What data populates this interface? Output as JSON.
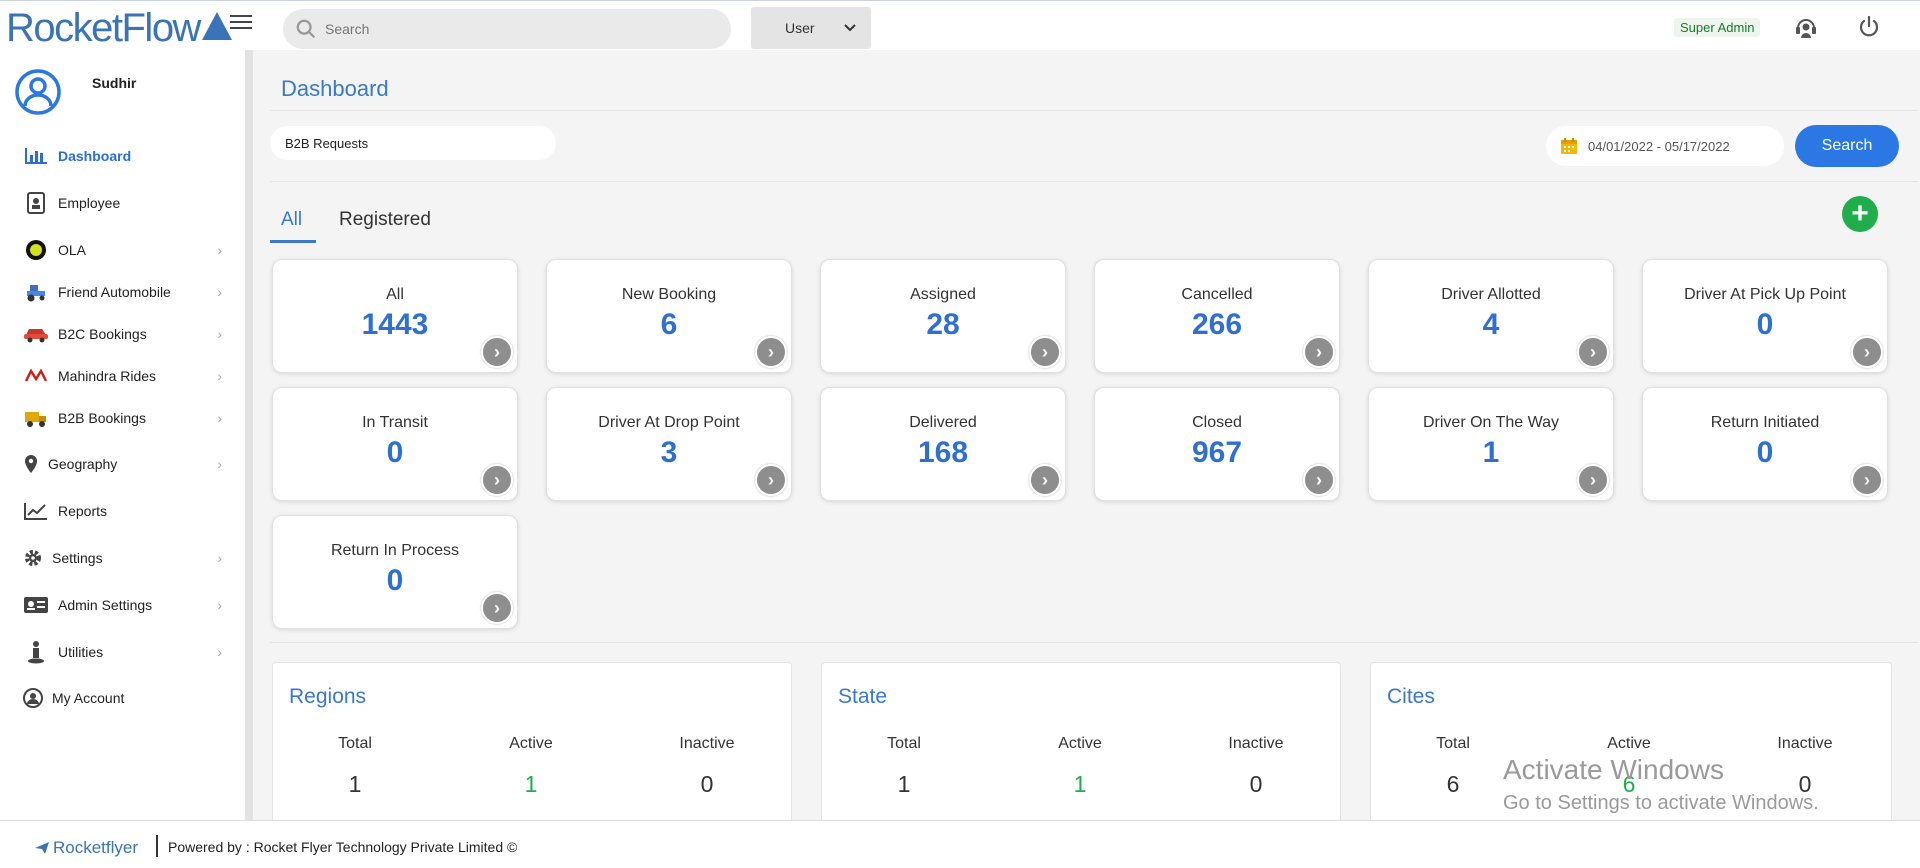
{
  "header": {
    "logo_text": "RocketFlow",
    "search_placeholder": "Search",
    "user_select": "User",
    "role_badge": "Super Admin"
  },
  "sidebar": {
    "user_name": "Sudhir",
    "items": [
      {
        "label": "Dashboard",
        "icon": "bar-chart-icon",
        "active": true
      },
      {
        "label": "Employee",
        "icon": "id-badge-icon"
      },
      {
        "label": "OLA",
        "icon": "ola-logo-icon"
      },
      {
        "label": "Friend Automobile",
        "icon": "tractor-icon"
      },
      {
        "label": "B2C Bookings",
        "icon": "car-icon"
      },
      {
        "label": "Mahindra Rides",
        "icon": "mahindra-logo-icon"
      },
      {
        "label": "B2B Bookings",
        "icon": "truck-icon"
      },
      {
        "label": "Geography",
        "icon": "map-pin-icon"
      },
      {
        "label": "Reports",
        "icon": "line-chart-icon"
      },
      {
        "label": "Settings",
        "icon": "gear-icon"
      },
      {
        "label": "Admin Settings",
        "icon": "admin-card-icon"
      },
      {
        "label": "Utilities",
        "icon": "person-icon"
      },
      {
        "label": "My Account",
        "icon": "account-icon"
      }
    ]
  },
  "main": {
    "title": "Dashboard",
    "request_type": "B2B Requests",
    "date_range": "04/01/2022 - 05/17/2022",
    "search_button": "Search",
    "tabs": [
      {
        "label": "All",
        "active": true
      },
      {
        "label": "Registered"
      }
    ],
    "stats": [
      {
        "label": "All",
        "value": "1443"
      },
      {
        "label": "New Booking",
        "value": "6"
      },
      {
        "label": "Assigned",
        "value": "28"
      },
      {
        "label": "Cancelled",
        "value": "266"
      },
      {
        "label": "Driver Allotted",
        "value": "4"
      },
      {
        "label": "Driver At Pick Up Point",
        "value": "0"
      },
      {
        "label": "In Transit",
        "value": "0"
      },
      {
        "label": "Driver At Drop Point",
        "value": "3"
      },
      {
        "label": "Delivered",
        "value": "168"
      },
      {
        "label": "Closed",
        "value": "967"
      },
      {
        "label": "Driver On The Way",
        "value": "1"
      },
      {
        "label": "Return Initiated",
        "value": "0"
      },
      {
        "label": "Return In Process",
        "value": "0"
      }
    ],
    "geo": [
      {
        "title": "Regions",
        "total_label": "Total",
        "active_label": "Active",
        "inactive_label": "Inactive",
        "total": "1",
        "active": "1",
        "inactive": "0"
      },
      {
        "title": "State",
        "total_label": "Total",
        "active_label": "Active",
        "inactive_label": "Inactive",
        "total": "1",
        "active": "1",
        "inactive": "0"
      },
      {
        "title": "Cites",
        "total_label": "Total",
        "active_label": "Active",
        "inactive_label": "Inactive",
        "total": "6",
        "active": "6",
        "inactive": "0"
      }
    ]
  },
  "footer": {
    "brand": "Rocketflyer",
    "powered_by": "Powered by : Rocket Flyer Technology Private Limited ©"
  },
  "watermark": {
    "line1": "Activate Windows",
    "line2": "Go to Settings to activate Windows."
  },
  "colors": {
    "accent": "#2b78e4",
    "title_blue": "#3a78c8",
    "value_blue": "#2f6fd1",
    "green": "#1fae4b"
  }
}
